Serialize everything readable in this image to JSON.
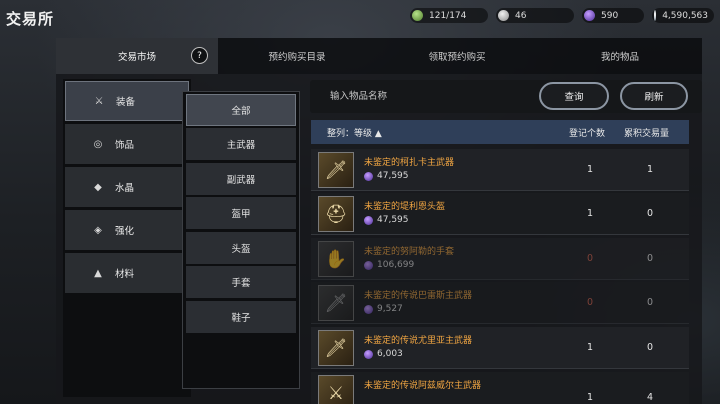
{
  "app": {
    "title": "交易所"
  },
  "currencies": [
    {
      "icon": "green-coin-icon",
      "value": "121/174"
    },
    {
      "icon": "silver-coin-icon",
      "value": "46"
    },
    {
      "icon": "purple-gem-icon",
      "value": "590"
    },
    {
      "icon": "white-coin-icon",
      "value": "4,590,563"
    }
  ],
  "tabs": [
    {
      "label": "交易市场",
      "active": true
    },
    {
      "label": "预约购买目录",
      "active": false
    },
    {
      "label": "领取预约购买",
      "active": false
    },
    {
      "label": "我的物品",
      "active": false
    }
  ],
  "help_icon": "?",
  "categories": [
    {
      "label": "装备",
      "icon": "crossed-swords-icon",
      "active": true
    },
    {
      "label": "饰品",
      "icon": "ring-icon",
      "active": false
    },
    {
      "label": "水晶",
      "icon": "crystal-icon",
      "active": false
    },
    {
      "label": "强化",
      "icon": "enhance-icon",
      "active": false
    },
    {
      "label": "材料",
      "icon": "potion-icon",
      "active": false
    }
  ],
  "subcategories": [
    {
      "label": "全部",
      "active": true
    },
    {
      "label": "主武器",
      "active": false
    },
    {
      "label": "副武器",
      "active": false
    },
    {
      "label": "盔甲",
      "active": false
    },
    {
      "label": "头盔",
      "active": false
    },
    {
      "label": "手套",
      "active": false
    },
    {
      "label": "鞋子",
      "active": false
    }
  ],
  "search": {
    "placeholder": "输入物品名称",
    "query_label": "查询",
    "refresh_label": "刷新"
  },
  "table": {
    "sort_label": "整列：等级",
    "sort_arrow": "▲",
    "col_registered": "登记个数",
    "col_volume": "累积交易量",
    "rows": [
      {
        "name": "未鉴定的柯扎卡主武器",
        "price": "47,595",
        "registered": "1",
        "volume": "1",
        "icon": "sword-icon",
        "dim": false
      },
      {
        "name": "未鉴定的堤利恩头盔",
        "price": "47,595",
        "registered": "1",
        "volume": "0",
        "icon": "helmet-icon",
        "dim": false
      },
      {
        "name": "未鉴定的努阿勒的手套",
        "price": "106,699",
        "registered": "0",
        "volume": "0",
        "icon": "gauntlet-icon",
        "dim": true
      },
      {
        "name": "未鉴定的传说巴雷斯主武器",
        "price": "9,527",
        "registered": "0",
        "volume": "0",
        "icon": "sword-icon",
        "dim": true
      },
      {
        "name": "未鉴定的传说尤里亚主武器",
        "price": "6,003",
        "registered": "1",
        "volume": "0",
        "icon": "sword-icon",
        "dim": false
      },
      {
        "name": "未鉴定的传说阿兹威尔主武器",
        "price": "",
        "registered": "1",
        "volume": "4",
        "icon": "crossed-swords-icon",
        "dim": false
      }
    ]
  }
}
